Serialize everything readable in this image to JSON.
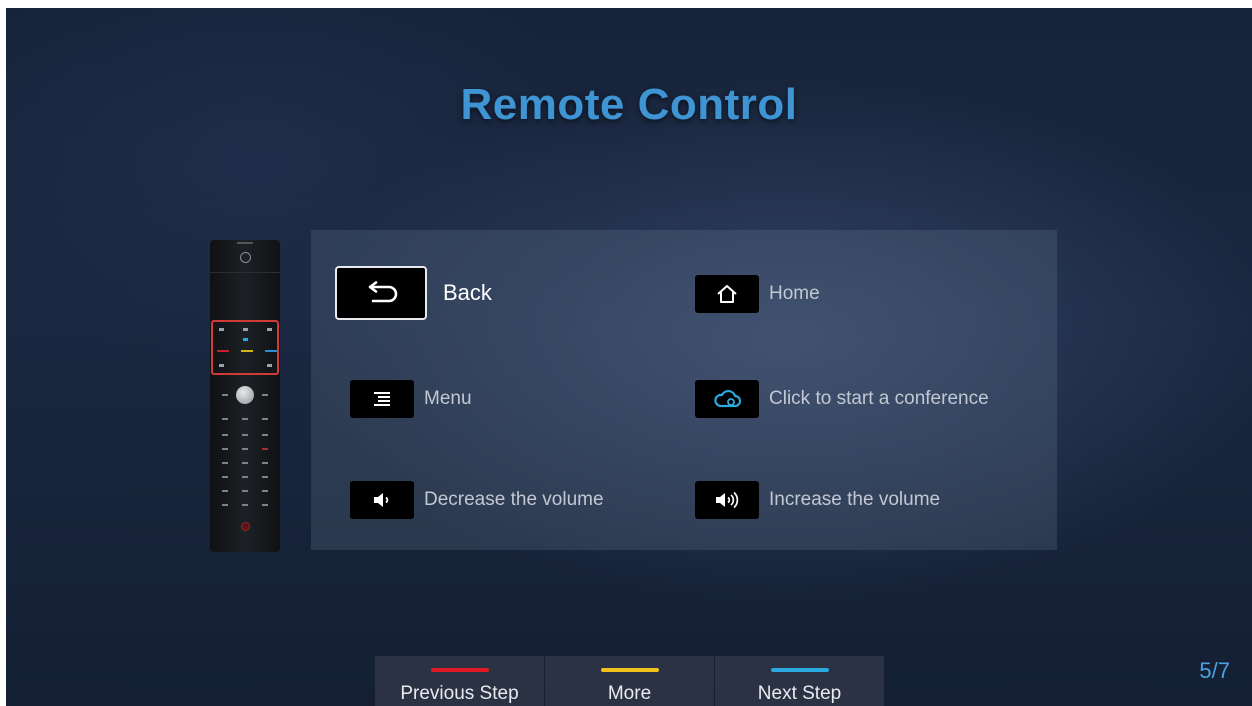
{
  "title": "Remote Control",
  "items": [
    {
      "label": "Back",
      "icon": "back-arrow-icon",
      "selected": true
    },
    {
      "label": "Home",
      "icon": "home-icon"
    },
    {
      "label": "Menu",
      "icon": "menu-icon"
    },
    {
      "label": "Click to start a conference",
      "icon": "cloud-icon"
    },
    {
      "label": "Decrease the volume",
      "icon": "volume-down-icon"
    },
    {
      "label": "Increase the volume",
      "icon": "volume-up-icon"
    }
  ],
  "footer": {
    "previous": {
      "label": "Previous Step",
      "color": "#e01b24"
    },
    "more": {
      "label": "More",
      "color": "#f2c21b"
    },
    "next": {
      "label": "Next Step",
      "color": "#2ba8e0"
    }
  },
  "page_indicator": "5/7",
  "colors": {
    "accent": "#3f95d4",
    "highlight": "#d23a3a",
    "cloud": "#2ba8e0"
  }
}
